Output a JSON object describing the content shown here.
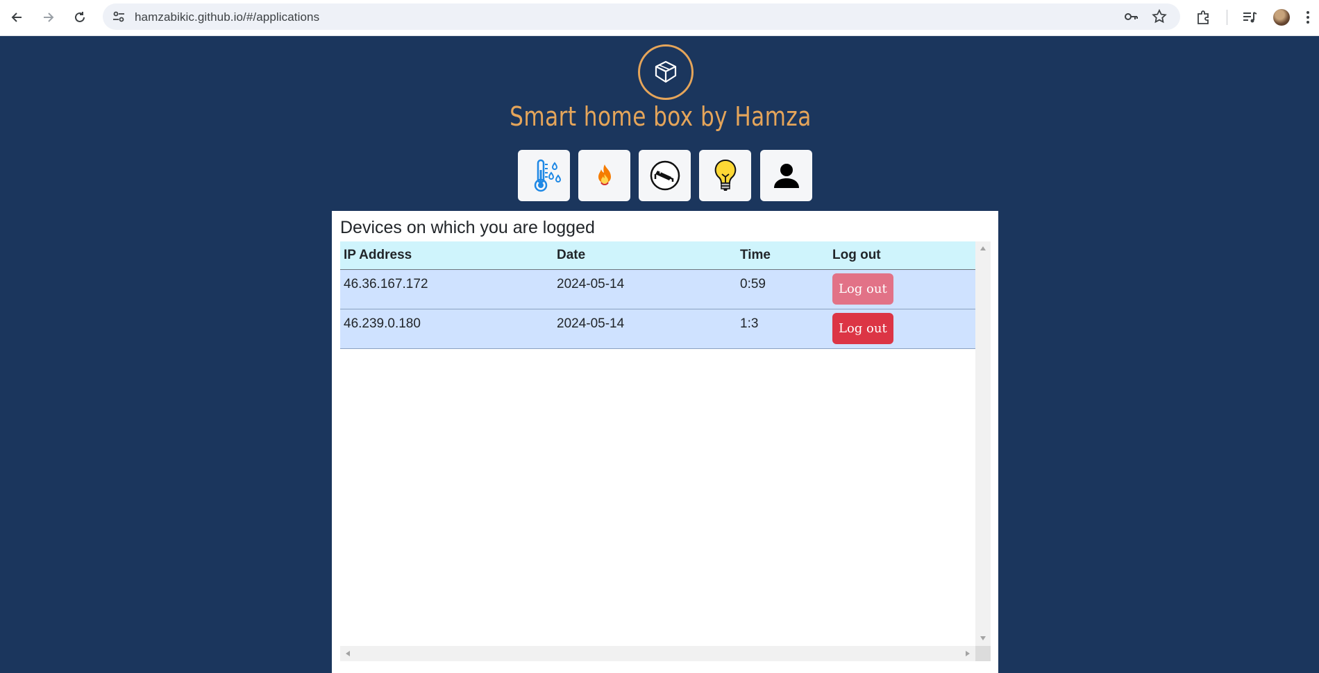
{
  "browser": {
    "url": "hamzabikic.github.io/#/applications"
  },
  "site": {
    "title": "Smart home box by Hamza"
  },
  "apps": [
    {
      "name": "temperature-humidity"
    },
    {
      "name": "fire-alarm"
    },
    {
      "name": "camera"
    },
    {
      "name": "lights"
    },
    {
      "name": "profile"
    }
  ],
  "panel": {
    "title": "Devices on which you are logged",
    "columns": [
      "IP Address",
      "Date",
      "Time",
      "Log out"
    ],
    "rows": [
      {
        "ip": "46.36.167.172",
        "date": "2024-05-14",
        "time": "0:59",
        "action": "Log out"
      },
      {
        "ip": "46.239.0.180",
        "date": "2024-05-14",
        "time": "1:3",
        "action": "Log out"
      }
    ]
  },
  "colors": {
    "page_bg": "#1b365d",
    "brand_orange": "#e5a55a",
    "logout_faded": "#e27287",
    "logout_active": "#dc3545",
    "table_header": "#cff4fc",
    "table_row": "#cfe2ff"
  }
}
